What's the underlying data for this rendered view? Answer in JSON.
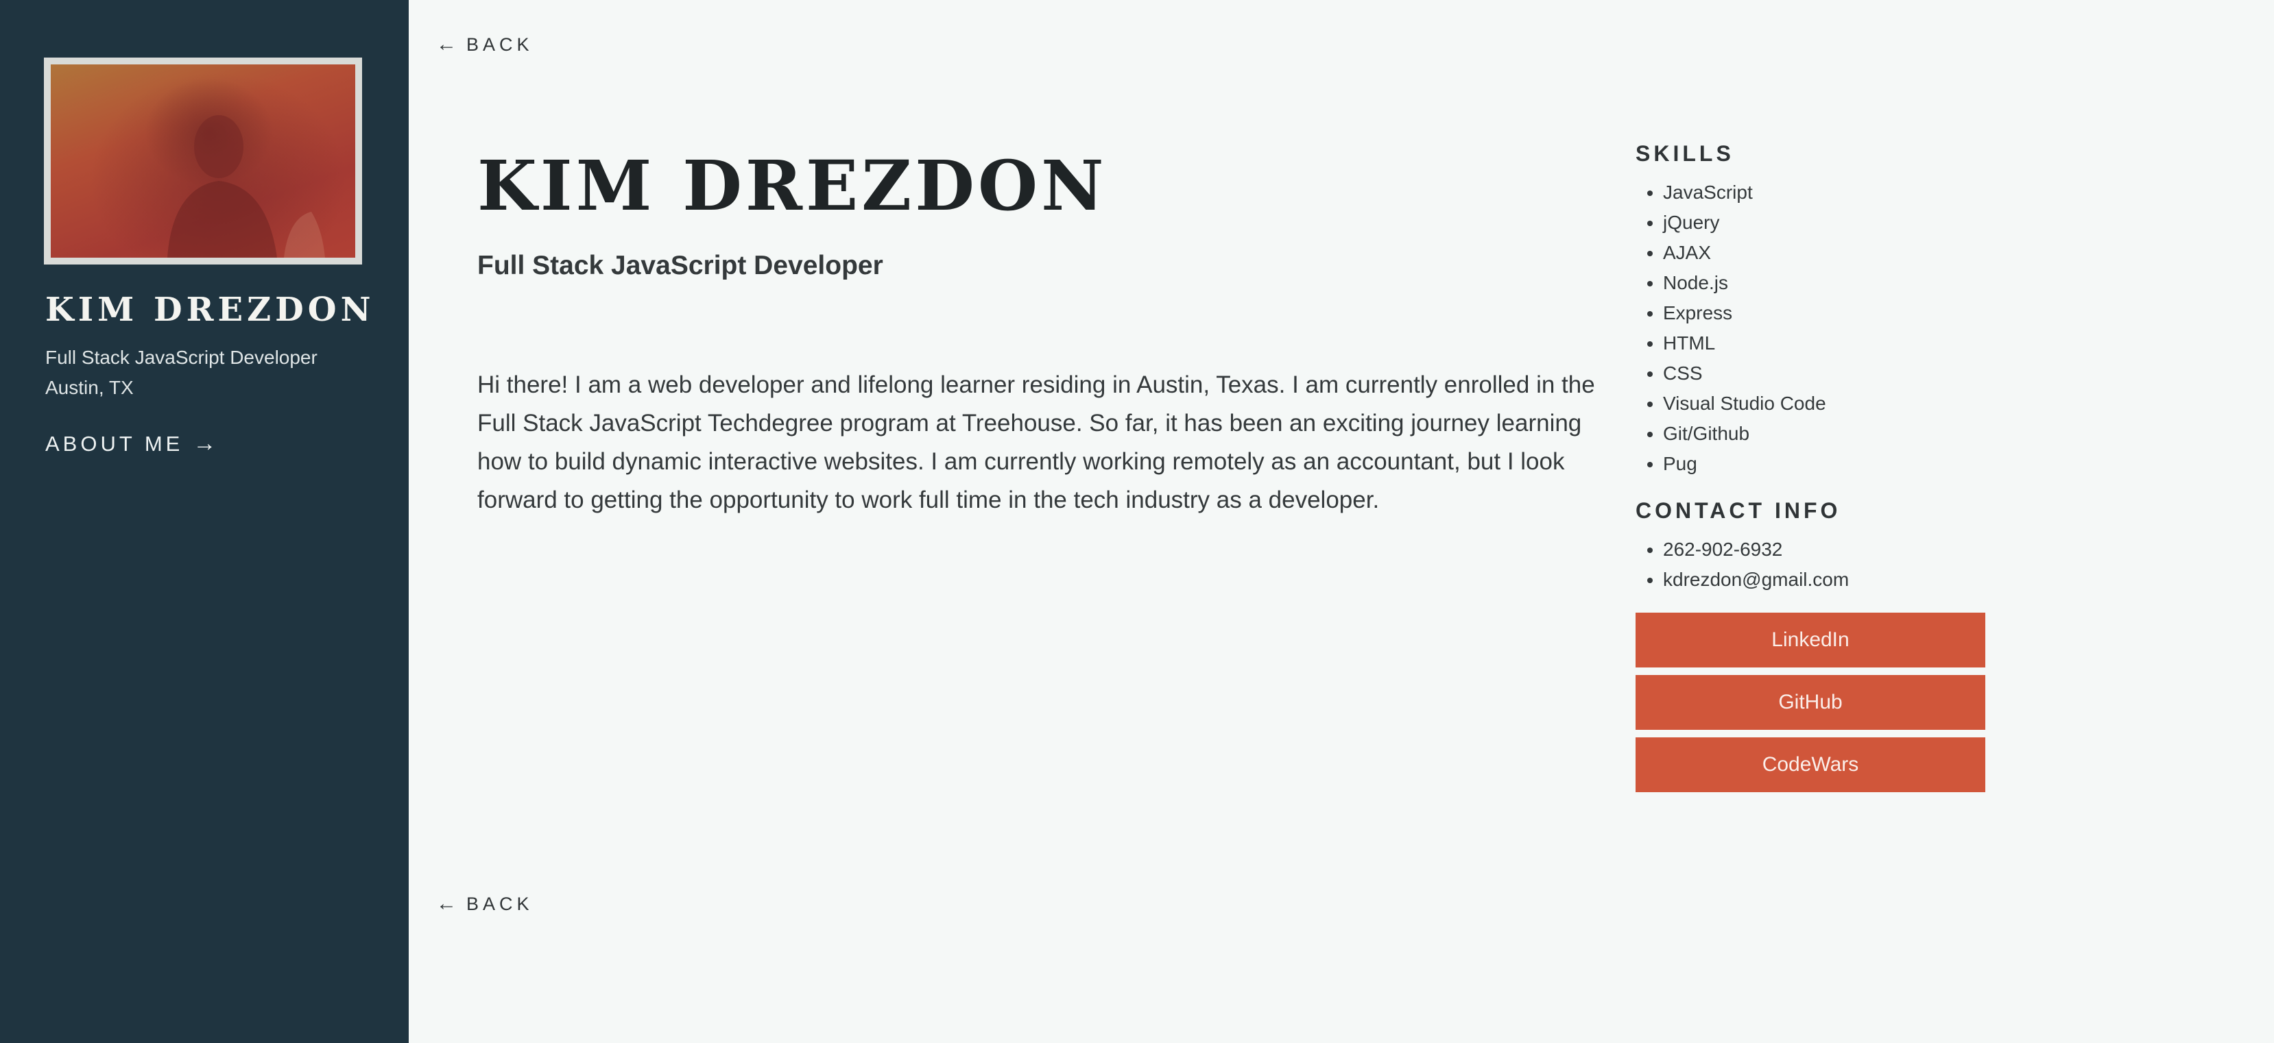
{
  "sidebar": {
    "photo_alt": "Profile photo",
    "name": "KIM DREZDON",
    "role": "Full Stack JavaScript Developer",
    "location": "Austin, TX",
    "about_label": "ABOUT ME",
    "about_arrow": "→"
  },
  "nav": {
    "back_arrow": "←",
    "back_label": "BACK"
  },
  "main": {
    "name": "KIM DREZDON",
    "role": "Full Stack JavaScript Developer",
    "bio": "Hi there! I am a web developer and lifelong learner residing in Austin, Texas. I am currently enrolled in the Full Stack JavaScript Techdegree program at Treehouse. So far, it has been an exciting journey learning how to build dynamic interactive websites. I am currently working remotely as an accountant, but I look forward to getting the opportunity to work full time in the tech industry as a developer."
  },
  "skills": {
    "title": "SKILLS",
    "items": [
      "JavaScript",
      "jQuery",
      "AJAX",
      "Node.js",
      "Express",
      "HTML",
      "CSS",
      "Visual Studio Code",
      "Git/Github",
      "Pug"
    ]
  },
  "contact": {
    "title": "CONTACT INFO",
    "items": [
      "262-902-6932",
      "kdrezdon@gmail.com"
    ]
  },
  "links": {
    "linkedin": "LinkedIn",
    "github": "GitHub",
    "codewars": "CodeWars"
  },
  "colors": {
    "sidebar_bg": "#1f3440",
    "page_bg": "#f5f8f7",
    "button_bg": "#d0563a",
    "text": "#2f3436"
  }
}
